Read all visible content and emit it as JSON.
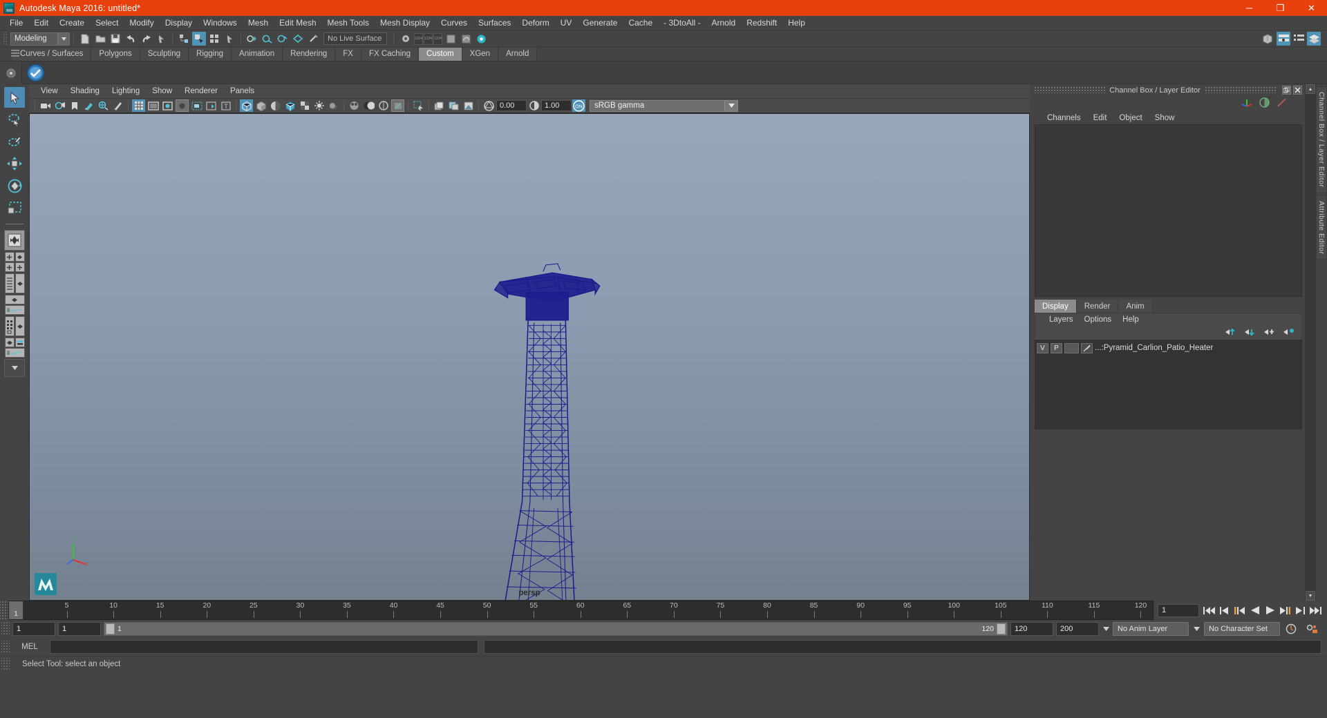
{
  "window": {
    "title": "Autodesk Maya 2016: untitled*",
    "minimize": "─",
    "maximize": "❐",
    "close": "✕"
  },
  "menubar": {
    "items": [
      "File",
      "Edit",
      "Create",
      "Select",
      "Modify",
      "Display",
      "Windows",
      "Mesh",
      "Edit Mesh",
      "Mesh Tools",
      "Mesh Display",
      "Curves",
      "Surfaces",
      "Deform",
      "UV",
      "Generate",
      "Cache",
      "- 3DtoAll -",
      "Arnold",
      "Redshift",
      "Help"
    ]
  },
  "statusline": {
    "menuset": "Modeling",
    "live_surface": "No Live Surface"
  },
  "shelf": {
    "tabs": [
      "Curves / Surfaces",
      "Polygons",
      "Sculpting",
      "Rigging",
      "Animation",
      "Rendering",
      "FX",
      "FX Caching",
      "Custom",
      "XGen",
      "Arnold"
    ],
    "active_tab": "Custom"
  },
  "viewport": {
    "menus": [
      "View",
      "Shading",
      "Lighting",
      "Show",
      "Renderer",
      "Panels"
    ],
    "exposure": "0.00",
    "gamma": "1.00",
    "color_management": "sRGB gamma",
    "camera_label": "persp",
    "axis_labels": {
      "y": "Y",
      "x": "X",
      "z": "Z"
    }
  },
  "channel_box": {
    "title": "Channel Box / Layer Editor",
    "menus": [
      "Channels",
      "Edit",
      "Object",
      "Show"
    ]
  },
  "layer_editor": {
    "tabs": [
      "Display",
      "Render",
      "Anim"
    ],
    "active_tab": "Display",
    "menus": [
      "Layers",
      "Options",
      "Help"
    ],
    "layers": [
      {
        "visible": "V",
        "playback": "P",
        "color": "",
        "name": "...:Pyramid_Carlion_Patio_Heater"
      }
    ]
  },
  "side_tabs": [
    "Channel Box / Layer Editor",
    "Attribute Editor"
  ],
  "timeline": {
    "ticks": [
      5,
      10,
      15,
      20,
      25,
      30,
      35,
      40,
      45,
      50,
      55,
      60,
      65,
      70,
      75,
      80,
      85,
      90,
      95,
      100,
      105,
      110,
      115,
      120
    ],
    "current_frame": "1",
    "frame_field": "1",
    "range_start": "1",
    "range_end": "1",
    "playback_start": "1",
    "playback_end": "120",
    "anim_end": "120",
    "anim_range_max": "200",
    "anim_layer": "No Anim Layer",
    "character_set": "No Character Set"
  },
  "command_line": {
    "language": "MEL",
    "value": "",
    "placeholder": ""
  },
  "status": {
    "message": "Select Tool: select an object"
  },
  "colors": {
    "title_bar": "#e8400c",
    "accent": "#4f94b8",
    "panel_bg": "#444444",
    "model_wireframe": "#1a1a8c"
  }
}
